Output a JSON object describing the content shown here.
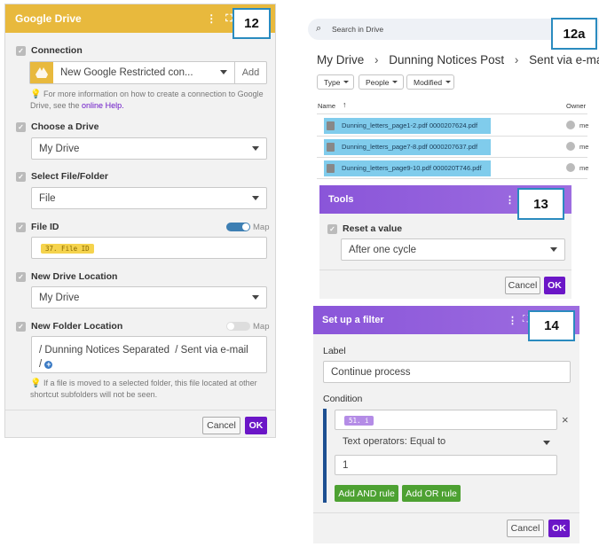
{
  "panel12": {
    "title": "Google Drive",
    "step": "12",
    "connection": {
      "label": "Connection",
      "value": "New Google Restricted con...",
      "add_label": "Add",
      "note_text": "For more information on how to create a connection to Google Drive, see the",
      "note_link": "online Help."
    },
    "choose_drive": {
      "label": "Choose a Drive",
      "value": "My Drive"
    },
    "select_file_folder": {
      "label": "Select File/Folder",
      "value": "File"
    },
    "file_id": {
      "label": "File ID",
      "map_label": "Map",
      "map_on": true,
      "chip": "37. File ID"
    },
    "new_drive_location": {
      "label": "New Drive Location",
      "value": "My Drive"
    },
    "new_folder_location": {
      "label": "New Folder Location",
      "map_label": "Map",
      "map_on": false,
      "sep": "/",
      "part1": "Dunning Notices Separated",
      "part2": "Sent via e-mail",
      "note": "If a file is moved to a selected folder, this file located at other shortcut subfolders will not be seen."
    },
    "cancel_label": "Cancel",
    "ok_label": "OK"
  },
  "panel12a": {
    "step": "12a",
    "search_placeholder": "Search in Drive",
    "breadcrumb": [
      "My Drive",
      "Dunning Notices Post",
      "Sent via e-mail"
    ],
    "filters": [
      "Type",
      "People",
      "Modified"
    ],
    "col_name": "Name",
    "col_owner": "Owner",
    "files": [
      {
        "name": "Dunning_letters_page1-2.pdf 0000207624.pdf",
        "owner": "me"
      },
      {
        "name": "Dunning_letters_page7-8.pdf 0000207637.pdf",
        "owner": "me"
      },
      {
        "name": "Dunning_letters_page9-10.pdf 000020T746.pdf",
        "owner": "me"
      }
    ]
  },
  "panel13": {
    "title": "Tools",
    "step": "13",
    "reset_label": "Reset a value",
    "reset_value": "After one cycle",
    "cancel_label": "Cancel",
    "ok_label": "OK"
  },
  "panel14": {
    "title": "Set up a filter",
    "step": "14",
    "label_label": "Label",
    "label_value": "Continue process",
    "condition_label": "Condition",
    "cond_chip": "51. i",
    "operator": "Text operators: Equal to",
    "value": "1",
    "and_label": "Add AND rule",
    "or_label": "Add OR rule",
    "cancel_label": "Cancel",
    "ok_label": "OK"
  },
  "colors": {
    "google_drive_header": "#e8b93d",
    "purple_header": "#8a55d9",
    "ok_button": "#6b16c7",
    "step_box_border": "#2a8bbf",
    "file_highlight": "#80ccec",
    "green_button": "#4da132"
  }
}
